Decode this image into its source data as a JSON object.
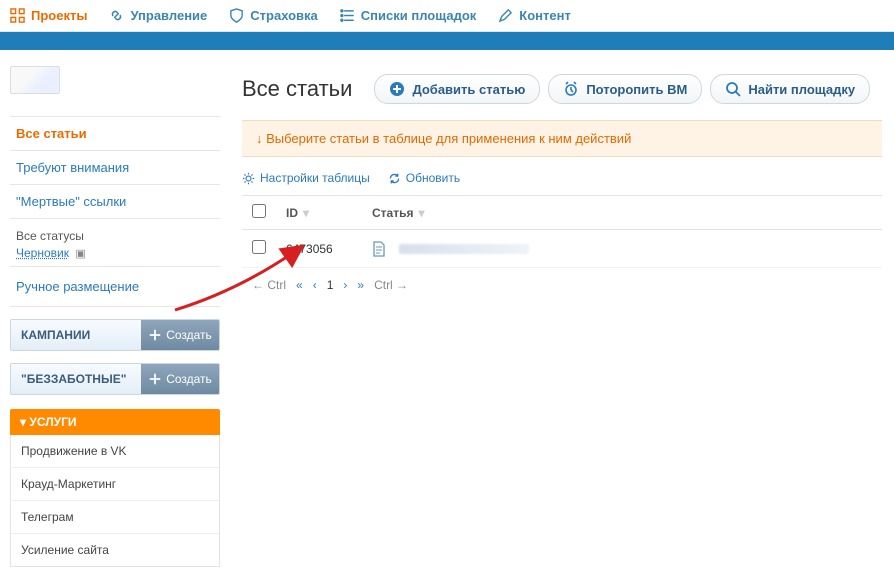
{
  "topnav": [
    {
      "label": "Проекты",
      "active": true
    },
    {
      "label": "Управление",
      "active": false
    },
    {
      "label": "Страховка",
      "active": false
    },
    {
      "label": "Списки площадок",
      "active": false
    },
    {
      "label": "Контент",
      "active": false
    }
  ],
  "sidebar": {
    "nav": [
      {
        "label": "Все статьи",
        "active": true
      },
      {
        "label": "Требуют внимания",
        "active": false
      },
      {
        "label": "\"Мертвые\" ссылки",
        "active": false
      }
    ],
    "status_title": "Все статусы",
    "draft_label": "Черновик",
    "manual_link": "Ручное размещение",
    "panels": [
      {
        "label": "КАМПАНИИ",
        "btn": "Создать"
      },
      {
        "label": "\"БЕЗЗАБОТНЫЕ\"",
        "btn": "Создать"
      }
    ],
    "services_header": "▾ УСЛУГИ",
    "services": [
      "Продвижение в VK",
      "Крауд-Маркетинг",
      "Телеграм",
      "Усиление сайта"
    ]
  },
  "main": {
    "title": "Все статьи",
    "buttons": {
      "add": "Добавить статью",
      "hurry": "Поторопить ВМ",
      "find": "Найти площадку"
    },
    "warning": "↓  Выберите статьи в таблице для применения к ним действий",
    "toolbar": {
      "settings": "Настройки таблицы",
      "refresh": "Обновить"
    },
    "columns": {
      "id": "ID",
      "article": "Статья"
    },
    "rows": [
      {
        "id": "6473056"
      }
    ],
    "pagination": {
      "ctrl_left": "← Ctrl",
      "first": "«",
      "prev": "‹",
      "page": "1",
      "next": "›",
      "last": "»",
      "ctrl_right": "Ctrl →"
    }
  }
}
